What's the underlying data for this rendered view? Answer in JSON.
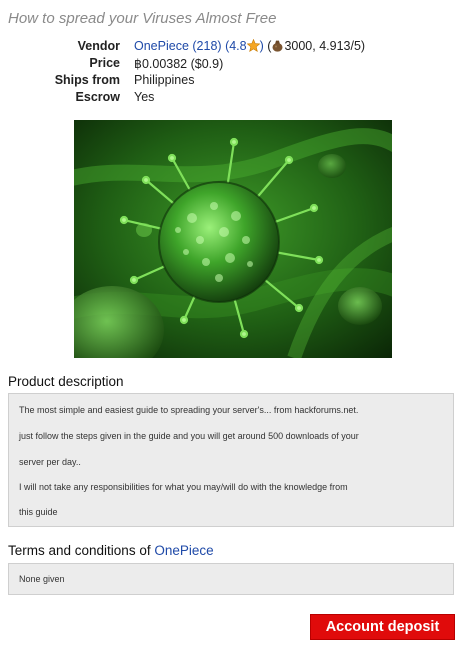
{
  "title": "How to spread your Viruses Almost Free",
  "vendor": {
    "label": "Vendor",
    "name": "OnePiece",
    "count": "(218)",
    "rating_open": "(4.8",
    "rating_close": ")",
    "feedback_open": "(",
    "feedback": "3000, 4.913/5)"
  },
  "price": {
    "label": "Price",
    "value": "฿0.00382 ($0.9)"
  },
  "ships_from": {
    "label": "Ships from",
    "value": "Philippines"
  },
  "escrow": {
    "label": "Escrow",
    "value": "Yes"
  },
  "product_description": {
    "heading": "Product description",
    "lines": [
      "The most simple and easiest guide to spreading your server's... from hackforums.net.",
      "just follow the steps given in the guide and you will get around 500 downloads of your",
      "server per day..",
      "I will not take any responsibilities for what you may/will do with the knowledge from",
      "this guide"
    ]
  },
  "terms": {
    "heading_prefix": "Terms and conditions of",
    "vendor_name": "OnePiece",
    "text": "None given"
  },
  "buy_button": "Account deposit",
  "icons": {
    "rating": "star-icon",
    "feedback": "money-bag-icon"
  },
  "colors": {
    "link": "#1f4aa8",
    "button": "#e00b0b",
    "box_bg": "#ececec"
  }
}
